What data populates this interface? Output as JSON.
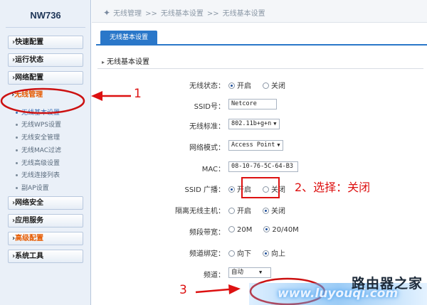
{
  "brand": {
    "model": "NW736"
  },
  "breadcrumb": {
    "items": [
      "无线管理",
      "无线基本设置",
      "无线基本设置"
    ],
    "separator": ">>"
  },
  "sidebar": {
    "menu": [
      {
        "label": "快速配置",
        "arrow": "›"
      },
      {
        "label": "运行状态",
        "arrow": "›"
      },
      {
        "label": "网络配置",
        "arrow": "›"
      },
      {
        "label": "无线管理",
        "arrow": "›",
        "active": true
      }
    ],
    "submenu": [
      "无线基本设置",
      "无线WPS设置",
      "无线安全管理",
      "无线MAC过滤",
      "无线高级设置",
      "无线连接列表",
      "副AP设置"
    ],
    "menu2": [
      {
        "label": "网络安全",
        "arrow": "›"
      },
      {
        "label": "应用服务",
        "arrow": "›"
      },
      {
        "label": "高级配置",
        "arrow": "›"
      },
      {
        "label": "系统工具",
        "arrow": "›"
      }
    ]
  },
  "tab": {
    "label": "无线基本设置"
  },
  "section": {
    "title": "无线基本设置"
  },
  "form": {
    "wireless_status": {
      "label": "无线状态：",
      "options": [
        "开启",
        "关闭"
      ],
      "selected": 0
    },
    "ssid": {
      "label": "SSID号：",
      "value": "Netcore"
    },
    "standard": {
      "label": "无线标准：",
      "value": "802.11b+g+n"
    },
    "mode": {
      "label": "网络模式：",
      "value": "Access Point"
    },
    "mac": {
      "label": "MAC：",
      "value": "08-10-76-5C-64-B3"
    },
    "ssid_broadcast": {
      "label": "SSID 广播：",
      "options": [
        "开启",
        "关闭"
      ],
      "selected": 0
    },
    "isolation": {
      "label": "隔离无线主机：",
      "options": [
        "开启",
        "关闭"
      ],
      "selected": 1
    },
    "bandwidth": {
      "label": "频段带宽：",
      "options": [
        "20M",
        "20/40M"
      ],
      "selected": 1
    },
    "channel_binding": {
      "label": "频道绑定：",
      "options": [
        "向下",
        "向上"
      ],
      "selected": 1
    },
    "channel": {
      "label": "频道：",
      "value": "自动"
    }
  },
  "annotations": {
    "num1": "1",
    "num2_text": "2、选择：关闭",
    "num3": "3"
  },
  "watermark": {
    "text": "路由器之家",
    "url": "www.luyouqi.com"
  },
  "colors": {
    "accent": "#2a77c9",
    "annotation": "#dd1111",
    "highlight": "#e65a00"
  }
}
